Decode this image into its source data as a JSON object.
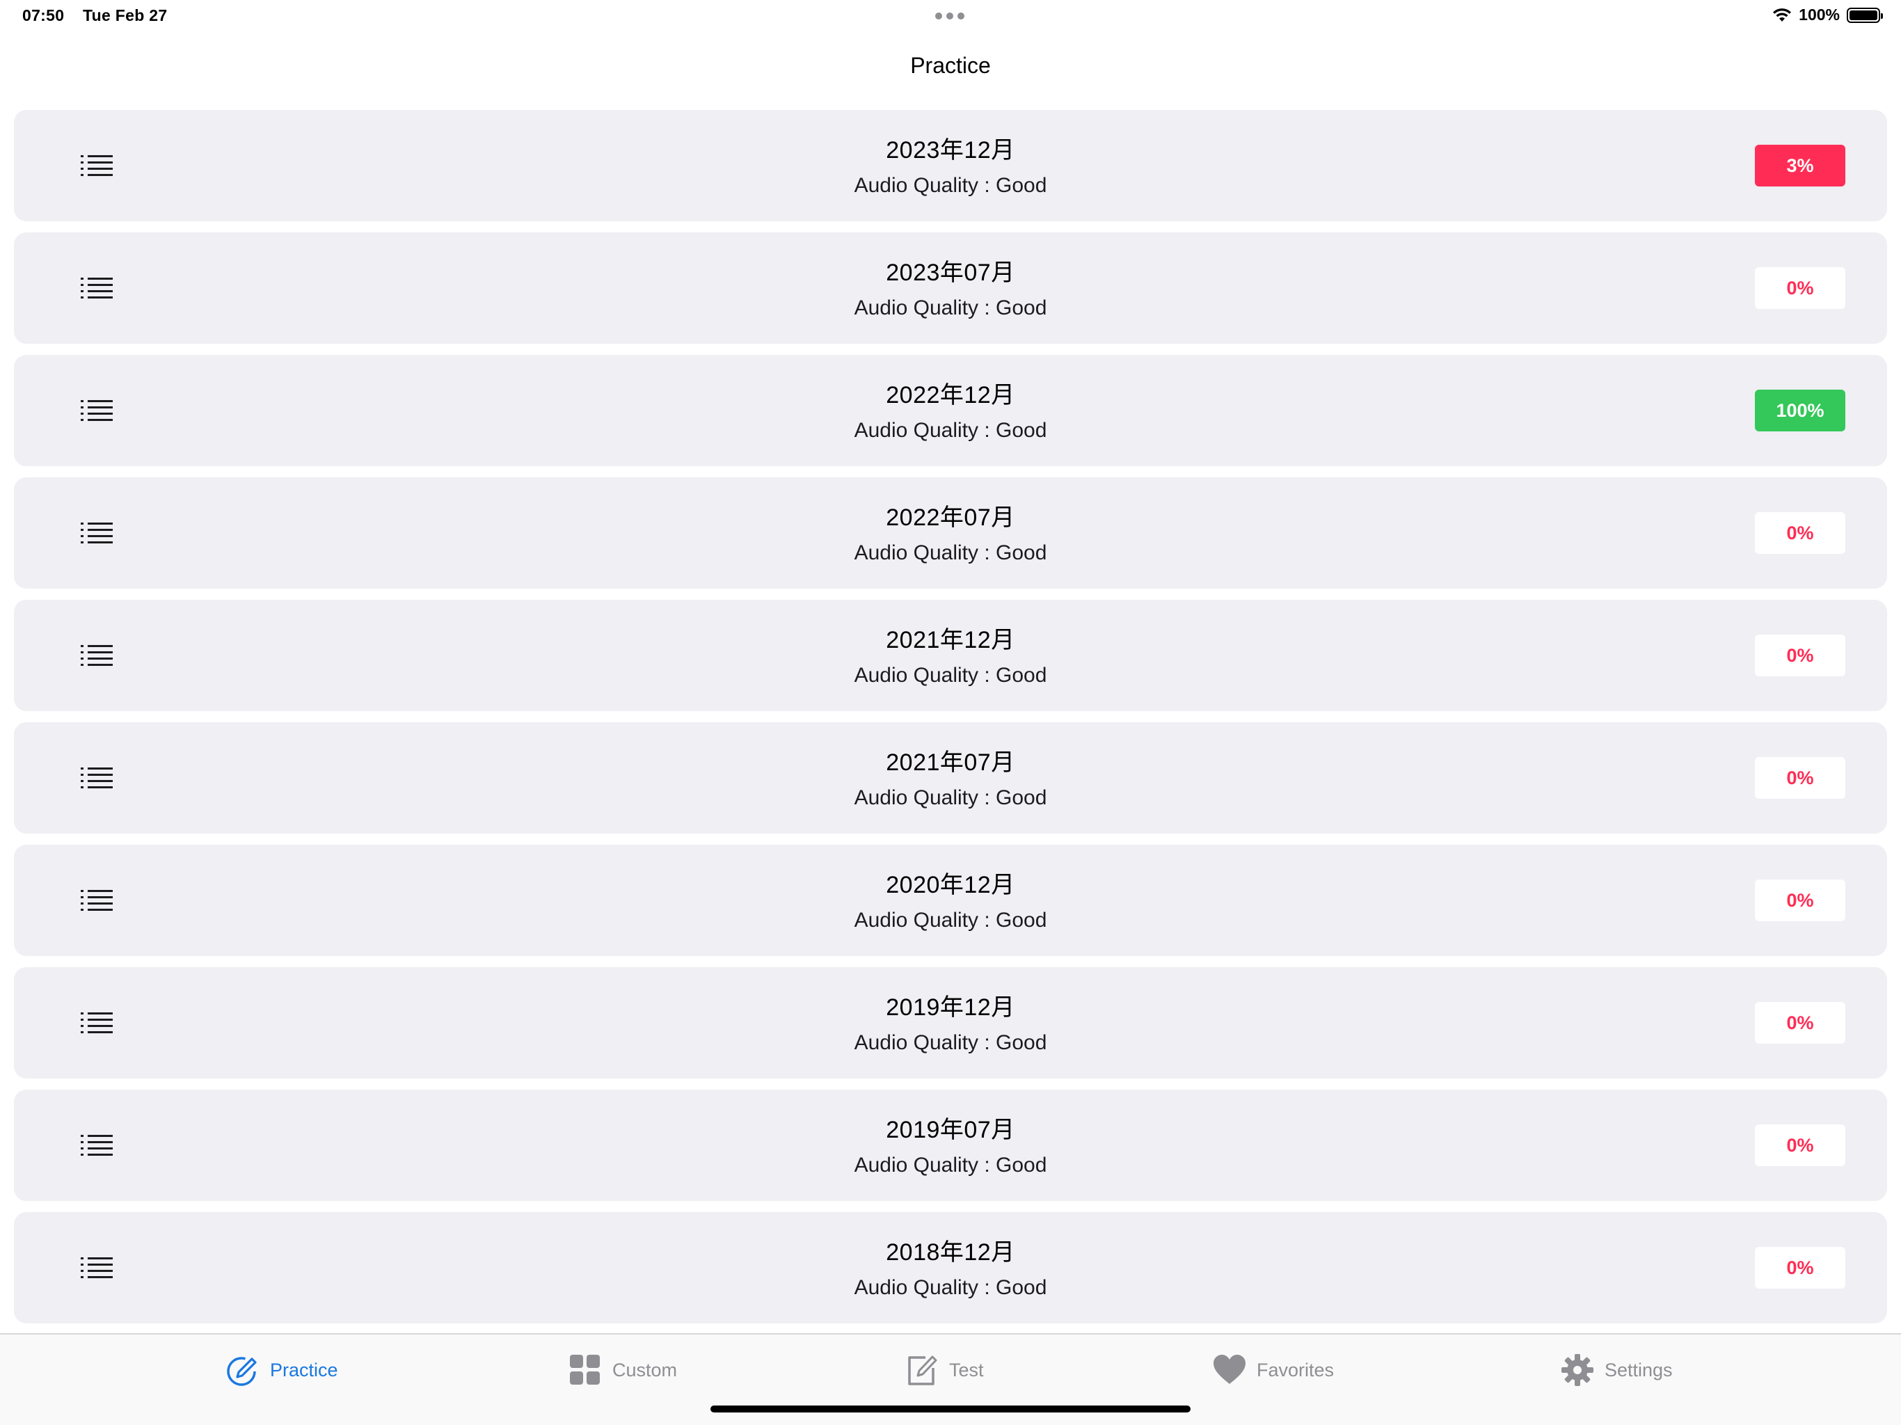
{
  "status_bar": {
    "time": "07:50",
    "date": "Tue Feb 27",
    "battery": "100%"
  },
  "nav": {
    "title": "Practice"
  },
  "rows": [
    {
      "title": "2023年12月",
      "subtitle": "Audio Quality : Good",
      "progress": "3%",
      "style": "red"
    },
    {
      "title": "2023年07月",
      "subtitle": "Audio Quality : Good",
      "progress": "0%",
      "style": "white"
    },
    {
      "title": "2022年12月",
      "subtitle": "Audio Quality : Good",
      "progress": "100%",
      "style": "green"
    },
    {
      "title": "2022年07月",
      "subtitle": "Audio Quality : Good",
      "progress": "0%",
      "style": "white"
    },
    {
      "title": "2021年12月",
      "subtitle": "Audio Quality : Good",
      "progress": "0%",
      "style": "white"
    },
    {
      "title": "2021年07月",
      "subtitle": "Audio Quality : Good",
      "progress": "0%",
      "style": "white"
    },
    {
      "title": "2020年12月",
      "subtitle": "Audio Quality : Good",
      "progress": "0%",
      "style": "white"
    },
    {
      "title": "2019年12月",
      "subtitle": "Audio Quality : Good",
      "progress": "0%",
      "style": "white"
    },
    {
      "title": "2019年07月",
      "subtitle": "Audio Quality : Good",
      "progress": "0%",
      "style": "white"
    },
    {
      "title": "2018年12月",
      "subtitle": "Audio Quality : Good",
      "progress": "0%",
      "style": "white"
    }
  ],
  "tabs": [
    {
      "label": "Practice",
      "icon": "pencil-circle-icon",
      "active": true
    },
    {
      "label": "Custom",
      "icon": "grid-icon",
      "active": false
    },
    {
      "label": "Test",
      "icon": "square-pencil-icon",
      "active": false
    },
    {
      "label": "Favorites",
      "icon": "heart-icon",
      "active": false
    },
    {
      "label": "Settings",
      "icon": "gear-icon",
      "active": false
    }
  ],
  "colors": {
    "accent": "#1a78e0",
    "badge_red": "#ff2d55",
    "badge_green": "#34c759",
    "row_background": "#efeff4"
  }
}
